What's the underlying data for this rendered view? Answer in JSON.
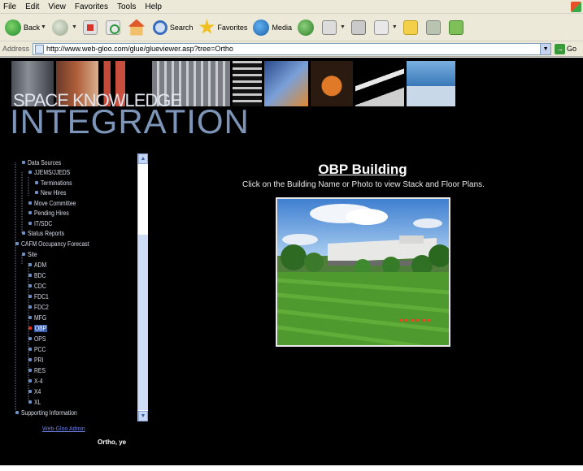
{
  "menubar": {
    "items": [
      "File",
      "Edit",
      "View",
      "Favorites",
      "Tools",
      "Help"
    ]
  },
  "toolbar": {
    "back_label": "Back",
    "search_label": "Search",
    "favorites_label": "Favorites",
    "media_label": "Media"
  },
  "addressbar": {
    "label": "Address",
    "url": "http://www.web-gloo.com/glue/glueviewer.asp?tree=Ortho",
    "go_label": "Go"
  },
  "header": {
    "title_line1": "SPACE KNOWLEDGE",
    "title_line2": "INTEGRATION"
  },
  "tree": {
    "items": [
      {
        "label": "Data Sources"
      },
      {
        "label": "JJEMS/JJEDS"
      },
      {
        "label": "Terminations"
      },
      {
        "label": "New Hires"
      },
      {
        "label": "Move Committee"
      },
      {
        "label": "Pending Hires"
      },
      {
        "label": "IT/SDC"
      },
      {
        "label": "Status Reports"
      },
      {
        "label": "CAFM Occupancy Forecast"
      },
      {
        "label": "Site"
      },
      {
        "label": "ADM"
      },
      {
        "label": "BDC"
      },
      {
        "label": "CDC"
      },
      {
        "label": "FDC1"
      },
      {
        "label": "FDC2"
      },
      {
        "label": "MFG"
      },
      {
        "label": "OBP"
      },
      {
        "label": "OPS"
      },
      {
        "label": "PCC"
      },
      {
        "label": "PRI"
      },
      {
        "label": "RES"
      },
      {
        "label": "X-4"
      },
      {
        "label": "X4"
      },
      {
        "label": "XL"
      },
      {
        "label": "Supporting Information"
      }
    ],
    "selected": "OBP"
  },
  "footer_link": "Web-Gloo Admin",
  "user_line": "Ortho, ye",
  "building": {
    "title": "OBP Building",
    "instruction": "Click on the Building Name or Photo to view Stack and Floor Plans."
  },
  "colors": {
    "page_background": "#000000",
    "chrome": "#ece9d8",
    "tree_text": "#d8dce8",
    "selected_highlight": "#3a5fb0",
    "logo_text": "#7c95b8"
  }
}
